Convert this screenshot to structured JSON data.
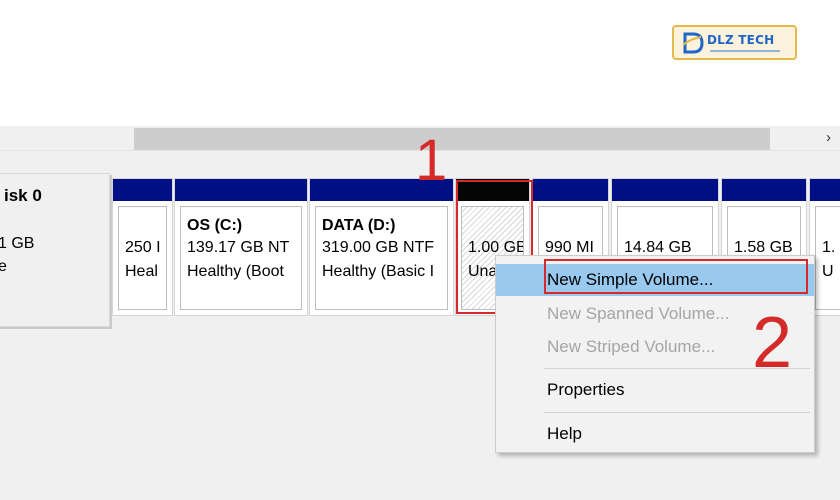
{
  "logo": {
    "text": "DLZ TECH",
    "icon": "dlz-tech-logo-icon"
  },
  "scrollbar": {
    "arrow": "›"
  },
  "disk": {
    "name": "isk 0",
    "size": "1 GB",
    "status": "e"
  },
  "partitions": [
    {
      "title": "",
      "line2": "250 I",
      "line3": "Heal"
    },
    {
      "title": "OS  (C:)",
      "line2": "139.17 GB NT",
      "line3": "Healthy (Boot"
    },
    {
      "title": "DATA  (D:)",
      "line2": "319.00 GB NTF",
      "line3": "Healthy (Basic I"
    },
    {
      "title": "",
      "line2": "1.00 GB",
      "line3": "Una"
    },
    {
      "title": "",
      "line2": "990 MI",
      "line3": ""
    },
    {
      "title": "",
      "line2": "14.84 GB",
      "line3": ""
    },
    {
      "title": "",
      "line2": "1.58 GB",
      "line3": ""
    },
    {
      "title": "",
      "line2": "1.",
      "line3": "U"
    }
  ],
  "annotations": {
    "step1": "1",
    "step2": "2",
    "color": "#d42a2a"
  },
  "context_menu": {
    "items": [
      {
        "label": "New Simple Volume...",
        "state": "highlighted"
      },
      {
        "label": "New Spanned Volume...",
        "state": "disabled"
      },
      {
        "label": "New Striped Volume...",
        "state": "disabled"
      },
      {
        "label": "Properties",
        "state": "enabled"
      },
      {
        "label": "Help",
        "state": "enabled"
      }
    ]
  },
  "colors": {
    "partition_bar": "#000f86",
    "unallocated_bar": "#050505",
    "menu_highlight": "#99c9ef",
    "accent_red": "#d42a2a"
  }
}
